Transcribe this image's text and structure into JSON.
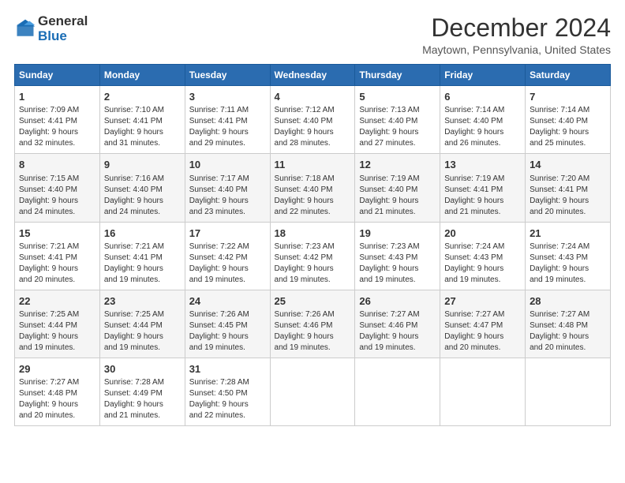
{
  "header": {
    "logo_general": "General",
    "logo_blue": "Blue",
    "main_title": "December 2024",
    "subtitle": "Maytown, Pennsylvania, United States"
  },
  "weekdays": [
    "Sunday",
    "Monday",
    "Tuesday",
    "Wednesday",
    "Thursday",
    "Friday",
    "Saturday"
  ],
  "weeks": [
    [
      {
        "day": "1",
        "lines": [
          "Sunrise: 7:09 AM",
          "Sunset: 4:41 PM",
          "Daylight: 9 hours",
          "and 32 minutes."
        ]
      },
      {
        "day": "2",
        "lines": [
          "Sunrise: 7:10 AM",
          "Sunset: 4:41 PM",
          "Daylight: 9 hours",
          "and 31 minutes."
        ]
      },
      {
        "day": "3",
        "lines": [
          "Sunrise: 7:11 AM",
          "Sunset: 4:41 PM",
          "Daylight: 9 hours",
          "and 29 minutes."
        ]
      },
      {
        "day": "4",
        "lines": [
          "Sunrise: 7:12 AM",
          "Sunset: 4:40 PM",
          "Daylight: 9 hours",
          "and 28 minutes."
        ]
      },
      {
        "day": "5",
        "lines": [
          "Sunrise: 7:13 AM",
          "Sunset: 4:40 PM",
          "Daylight: 9 hours",
          "and 27 minutes."
        ]
      },
      {
        "day": "6",
        "lines": [
          "Sunrise: 7:14 AM",
          "Sunset: 4:40 PM",
          "Daylight: 9 hours",
          "and 26 minutes."
        ]
      },
      {
        "day": "7",
        "lines": [
          "Sunrise: 7:14 AM",
          "Sunset: 4:40 PM",
          "Daylight: 9 hours",
          "and 25 minutes."
        ]
      }
    ],
    [
      {
        "day": "8",
        "lines": [
          "Sunrise: 7:15 AM",
          "Sunset: 4:40 PM",
          "Daylight: 9 hours",
          "and 24 minutes."
        ]
      },
      {
        "day": "9",
        "lines": [
          "Sunrise: 7:16 AM",
          "Sunset: 4:40 PM",
          "Daylight: 9 hours",
          "and 24 minutes."
        ]
      },
      {
        "day": "10",
        "lines": [
          "Sunrise: 7:17 AM",
          "Sunset: 4:40 PM",
          "Daylight: 9 hours",
          "and 23 minutes."
        ]
      },
      {
        "day": "11",
        "lines": [
          "Sunrise: 7:18 AM",
          "Sunset: 4:40 PM",
          "Daylight: 9 hours",
          "and 22 minutes."
        ]
      },
      {
        "day": "12",
        "lines": [
          "Sunrise: 7:19 AM",
          "Sunset: 4:40 PM",
          "Daylight: 9 hours",
          "and 21 minutes."
        ]
      },
      {
        "day": "13",
        "lines": [
          "Sunrise: 7:19 AM",
          "Sunset: 4:41 PM",
          "Daylight: 9 hours",
          "and 21 minutes."
        ]
      },
      {
        "day": "14",
        "lines": [
          "Sunrise: 7:20 AM",
          "Sunset: 4:41 PM",
          "Daylight: 9 hours",
          "and 20 minutes."
        ]
      }
    ],
    [
      {
        "day": "15",
        "lines": [
          "Sunrise: 7:21 AM",
          "Sunset: 4:41 PM",
          "Daylight: 9 hours",
          "and 20 minutes."
        ]
      },
      {
        "day": "16",
        "lines": [
          "Sunrise: 7:21 AM",
          "Sunset: 4:41 PM",
          "Daylight: 9 hours",
          "and 19 minutes."
        ]
      },
      {
        "day": "17",
        "lines": [
          "Sunrise: 7:22 AM",
          "Sunset: 4:42 PM",
          "Daylight: 9 hours",
          "and 19 minutes."
        ]
      },
      {
        "day": "18",
        "lines": [
          "Sunrise: 7:23 AM",
          "Sunset: 4:42 PM",
          "Daylight: 9 hours",
          "and 19 minutes."
        ]
      },
      {
        "day": "19",
        "lines": [
          "Sunrise: 7:23 AM",
          "Sunset: 4:43 PM",
          "Daylight: 9 hours",
          "and 19 minutes."
        ]
      },
      {
        "day": "20",
        "lines": [
          "Sunrise: 7:24 AM",
          "Sunset: 4:43 PM",
          "Daylight: 9 hours",
          "and 19 minutes."
        ]
      },
      {
        "day": "21",
        "lines": [
          "Sunrise: 7:24 AM",
          "Sunset: 4:43 PM",
          "Daylight: 9 hours",
          "and 19 minutes."
        ]
      }
    ],
    [
      {
        "day": "22",
        "lines": [
          "Sunrise: 7:25 AM",
          "Sunset: 4:44 PM",
          "Daylight: 9 hours",
          "and 19 minutes."
        ]
      },
      {
        "day": "23",
        "lines": [
          "Sunrise: 7:25 AM",
          "Sunset: 4:44 PM",
          "Daylight: 9 hours",
          "and 19 minutes."
        ]
      },
      {
        "day": "24",
        "lines": [
          "Sunrise: 7:26 AM",
          "Sunset: 4:45 PM",
          "Daylight: 9 hours",
          "and 19 minutes."
        ]
      },
      {
        "day": "25",
        "lines": [
          "Sunrise: 7:26 AM",
          "Sunset: 4:46 PM",
          "Daylight: 9 hours",
          "and 19 minutes."
        ]
      },
      {
        "day": "26",
        "lines": [
          "Sunrise: 7:27 AM",
          "Sunset: 4:46 PM",
          "Daylight: 9 hours",
          "and 19 minutes."
        ]
      },
      {
        "day": "27",
        "lines": [
          "Sunrise: 7:27 AM",
          "Sunset: 4:47 PM",
          "Daylight: 9 hours",
          "and 20 minutes."
        ]
      },
      {
        "day": "28",
        "lines": [
          "Sunrise: 7:27 AM",
          "Sunset: 4:48 PM",
          "Daylight: 9 hours",
          "and 20 minutes."
        ]
      }
    ],
    [
      {
        "day": "29",
        "lines": [
          "Sunrise: 7:27 AM",
          "Sunset: 4:48 PM",
          "Daylight: 9 hours",
          "and 20 minutes."
        ]
      },
      {
        "day": "30",
        "lines": [
          "Sunrise: 7:28 AM",
          "Sunset: 4:49 PM",
          "Daylight: 9 hours",
          "and 21 minutes."
        ]
      },
      {
        "day": "31",
        "lines": [
          "Sunrise: 7:28 AM",
          "Sunset: 4:50 PM",
          "Daylight: 9 hours",
          "and 22 minutes."
        ]
      },
      null,
      null,
      null,
      null
    ]
  ]
}
